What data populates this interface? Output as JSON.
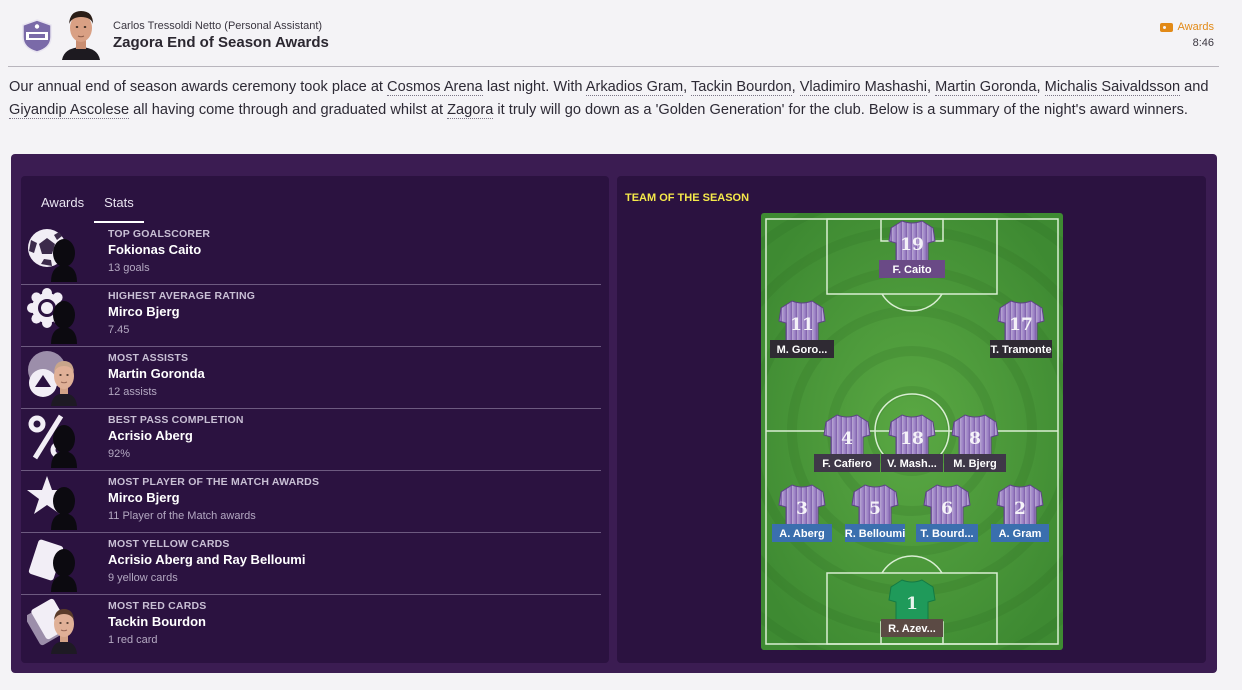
{
  "header": {
    "sender": "Carlos Tressoldi Netto",
    "sender_role": "(Personal Assistant)",
    "subject": "Zagora End of Season Awards",
    "tag": "Awards",
    "time": "8:46"
  },
  "body": {
    "segments": [
      {
        "t": "Our annual end of season awards ceremony took place at "
      },
      {
        "t": "Cosmos Arena",
        "link": true
      },
      {
        "t": " last night. With "
      },
      {
        "t": "Arkadios Gram",
        "link": true
      },
      {
        "t": ", "
      },
      {
        "t": "Tackin Bourdon",
        "link": true
      },
      {
        "t": ", "
      },
      {
        "t": "Vladimiro Mashashi",
        "link": true
      },
      {
        "t": ", "
      },
      {
        "t": "Martin Goronda",
        "link": true
      },
      {
        "t": ", "
      },
      {
        "t": "Michalis Saivaldsson",
        "link": true
      },
      {
        "t": " and "
      },
      {
        "t": "Giyandip Ascolese",
        "link": true
      },
      {
        "t": " all having come through and graduated whilst at "
      },
      {
        "t": "Zagora",
        "link": true
      },
      {
        "t": " it truly will go down as a 'Golden Generation' for the club. Below is a summary of the night's award winners."
      }
    ]
  },
  "tabs": [
    {
      "label": "Awards",
      "active": false
    },
    {
      "label": "Stats",
      "active": true
    }
  ],
  "awards": [
    {
      "category": "Top Goalscorer",
      "name": "Fokionas Caito",
      "detail": "13 goals",
      "icon": "football-icon",
      "photo": false
    },
    {
      "category": "Highest Average Rating",
      "name": "Mirco Bjerg",
      "detail": "7.45",
      "icon": "rosette-icon",
      "photo": false
    },
    {
      "category": "Most Assists",
      "name": "Martin Goronda",
      "detail": "12 assists",
      "icon": "assist-icon",
      "photo": true
    },
    {
      "category": "Best Pass Completion",
      "name": "Acrisio Aberg",
      "detail": "92%",
      "icon": "percent-icon",
      "photo": false
    },
    {
      "category": "Most Player of the Match Awards",
      "name": "Mirco Bjerg",
      "detail": "11 Player of the Match awards",
      "icon": "star-icon",
      "photo": false
    },
    {
      "category": "Most Yellow Cards",
      "name": "Acrisio Aberg and Ray Belloumi",
      "detail": "9 yellow cards",
      "icon": "yellow-card-icon",
      "photo": false
    },
    {
      "category": "Most Red Cards",
      "name": "Tackin Bourdon",
      "detail": "1 red card",
      "icon": "red-card-icon",
      "photo": true
    }
  ],
  "team_of_season": {
    "title": "TEAM OF THE SEASON",
    "players": [
      {
        "number": "19",
        "name": "F. Caito",
        "label_color": "#6a4a86",
        "goalkeeper": false
      },
      {
        "number": "11",
        "name": "M. Goro...",
        "label_color": "#2f2a33",
        "goalkeeper": false
      },
      {
        "number": "17",
        "name": "T. Tramonte",
        "label_color": "#2f2a33",
        "goalkeeper": false
      },
      {
        "number": "4",
        "name": "F. Cafiero",
        "label_color": "#3f3848",
        "goalkeeper": false
      },
      {
        "number": "18",
        "name": "V. Mash...",
        "label_color": "#3f3848",
        "goalkeeper": false
      },
      {
        "number": "8",
        "name": "M. Bjerg",
        "label_color": "#3f3848",
        "goalkeeper": false
      },
      {
        "number": "3",
        "name": "A. Aberg",
        "label_color": "#3a6fae",
        "goalkeeper": false
      },
      {
        "number": "5",
        "name": "R. Belloumi",
        "label_color": "#3a6fae",
        "goalkeeper": false
      },
      {
        "number": "6",
        "name": "T. Bourd...",
        "label_color": "#3a6fae",
        "goalkeeper": false
      },
      {
        "number": "2",
        "name": "A. Gram",
        "label_color": "#3a6fae",
        "goalkeeper": false
      },
      {
        "number": "1",
        "name": "R. Azev...",
        "label_color": "#5b4a44",
        "goalkeeper": true
      }
    ]
  },
  "colors": {
    "panel": "#3b1c52",
    "subpanel": "#2b1240",
    "accent": "#e28a17",
    "title_yellow": "#f5e94a",
    "pitch": "#4f9a3a",
    "shirt": "#8a6bb8",
    "keeper_shirt": "#1f9a5a"
  }
}
